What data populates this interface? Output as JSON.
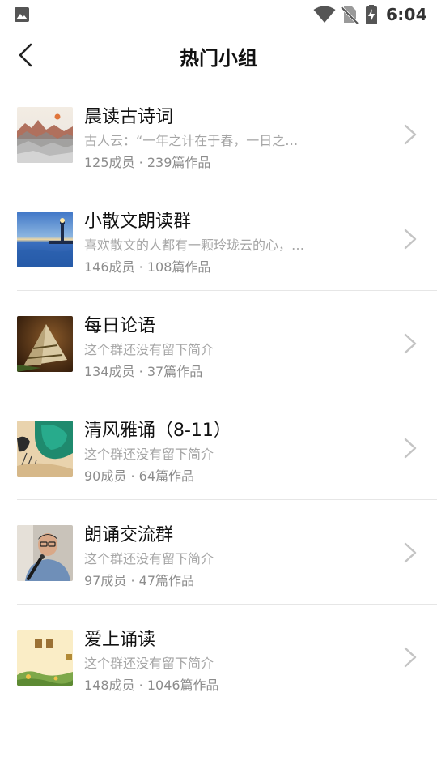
{
  "status_bar": {
    "time": "6:04",
    "icons": [
      "image-icon",
      "wifi-icon",
      "no-sim-icon",
      "battery-charging-icon"
    ]
  },
  "header": {
    "back_icon": "chevron-left-icon",
    "title": "热门小组"
  },
  "groups": [
    {
      "name": "晨读古诗词",
      "desc": "古人云：“一年之计在于春，一日之…",
      "members": "125成员",
      "works": "239篇作品",
      "thumb": "mountain-landscape"
    },
    {
      "name": "小散文朗读群",
      "desc": "喜欢散文的人都有一颗玲珑云的心，…",
      "members": "146成员",
      "works": "108篇作品",
      "thumb": "lighthouse-sea"
    },
    {
      "name": "每日论语",
      "desc": "这个群还没有留下简介",
      "members": "134成员",
      "works": "37篇作品",
      "thumb": "zongzi"
    },
    {
      "name": "清风雅诵（8-11）",
      "desc": "这个群还没有留下简介",
      "members": "90成员",
      "works": "64篇作品",
      "thumb": "green-ink-painting"
    },
    {
      "name": "朗诵交流群",
      "desc": "这个群还没有留下简介",
      "members": "97成员",
      "works": "47篇作品",
      "thumb": "man-with-microphone"
    },
    {
      "name": "爱上诵读",
      "desc": "这个群还没有留下简介",
      "members": "148成员",
      "works": "1046篇作品",
      "thumb": "reading-poster"
    }
  ],
  "meta_separator": "·",
  "colors": {
    "title": "#111111",
    "desc": "#a6a6a6",
    "meta": "#8c8c8c",
    "divider": "#e6e6e6",
    "chevron": "#c4c4c4"
  }
}
